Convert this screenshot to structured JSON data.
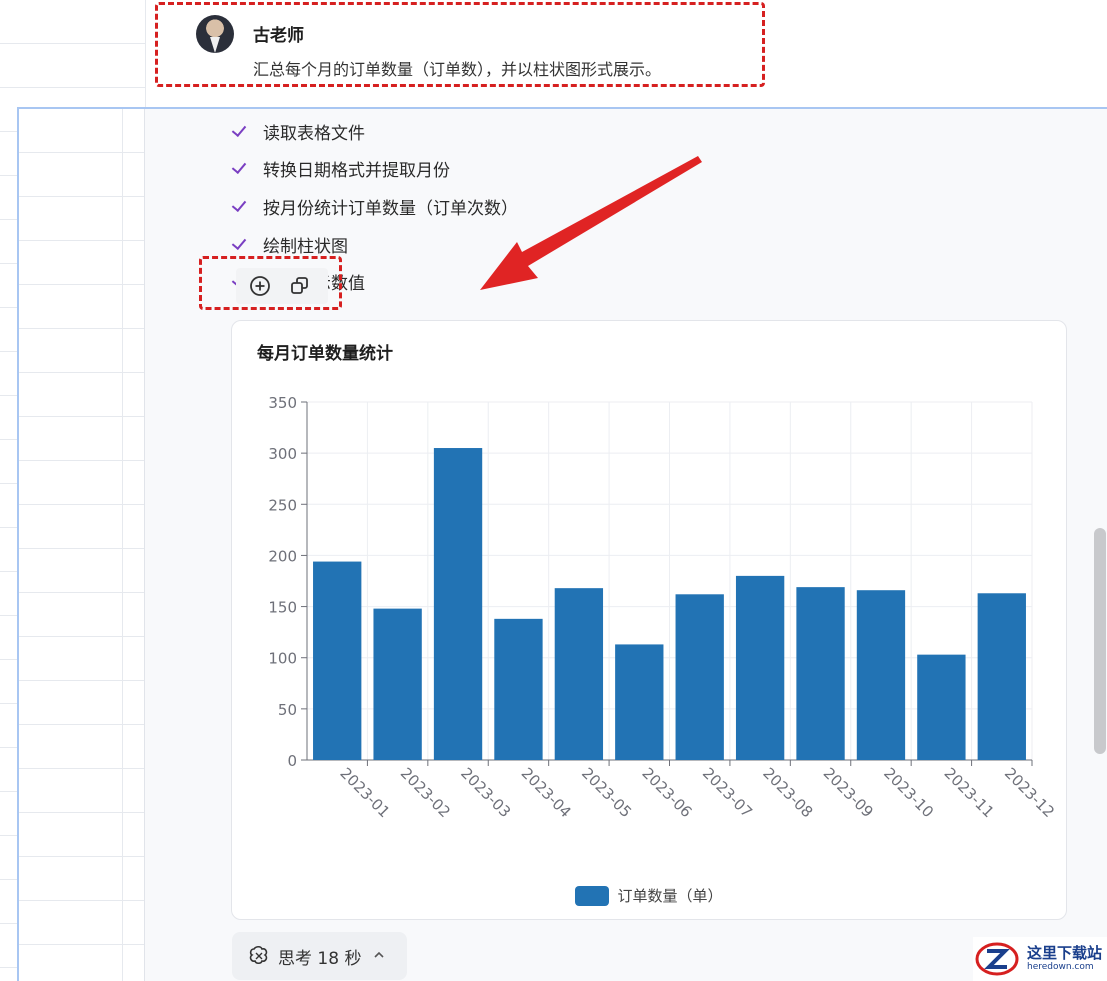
{
  "user_message": {
    "name": "古老师",
    "text": "汇总每个月的订单数量（订单数），并以柱状图形式展示。"
  },
  "steps": [
    {
      "label": "读取表格文件",
      "done": true
    },
    {
      "label": "转换日期格式并提取月份",
      "done": true
    },
    {
      "label": "按月份统计订单数量（订单次数）",
      "done": true
    },
    {
      "label": "绘制柱状图",
      "done": true
    },
    {
      "label": "上方显示数值",
      "done": true
    }
  ],
  "actions": {
    "insert_icon": "plus-circle-icon",
    "copy_icon": "copy-icon"
  },
  "chart_data": {
    "type": "bar",
    "title": "每月订单数量统计",
    "categories": [
      "2023-01",
      "2023-02",
      "2023-03",
      "2023-04",
      "2023-05",
      "2023-06",
      "2023-07",
      "2023-08",
      "2023-09",
      "2023-10",
      "2023-11",
      "2023-12"
    ],
    "series": [
      {
        "name": "订单数量（单）",
        "values": [
          194,
          148,
          305,
          138,
          168,
          113,
          162,
          180,
          169,
          166,
          103,
          163
        ],
        "color": "#2273b4"
      }
    ],
    "ylim": [
      0,
      350
    ],
    "yticks": [
      0,
      50,
      100,
      150,
      200,
      250,
      300,
      350
    ],
    "grid": true,
    "legend_position": "bottom-center"
  },
  "thinking": {
    "icon": "brain-beta-icon",
    "label": "思考 18 秒"
  },
  "watermark": {
    "text_cn": "这里下载站",
    "text_en": "heredown.com"
  },
  "colors": {
    "bar": "#2273b4",
    "annotation": "#d62020",
    "check": "#7a3fc2"
  }
}
